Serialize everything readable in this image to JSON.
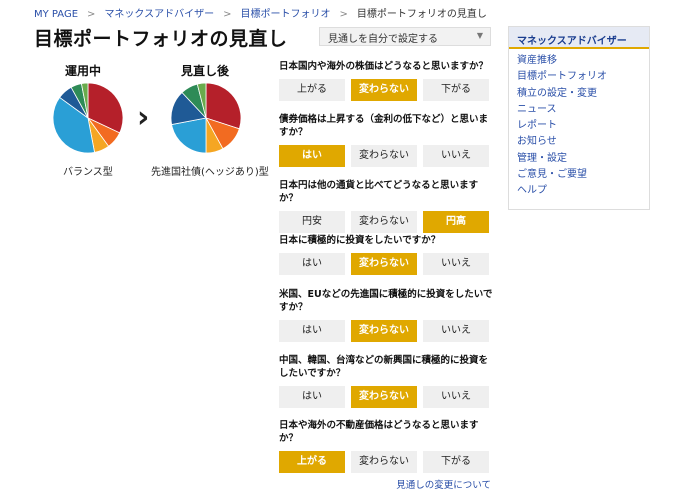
{
  "breadcrumb": [
    "MY PAGE",
    "マネックスアドバイザー",
    "目標ポートフォリオ",
    "目標ポートフォリオの見直し"
  ],
  "page_title": "目標ポートフォリオの見直し",
  "mode_select": {
    "value": "見通しを自分で設定する"
  },
  "current": {
    "label": "運用中",
    "caption": "バランス型"
  },
  "revised": {
    "label": "見直し後",
    "caption": "先進国社債(ヘッジあり)型"
  },
  "pie_colors": [
    "#b5202a",
    "#f26b21",
    "#f5a623",
    "#2a9fd6",
    "#1f5a96",
    "#2e8b57",
    "#6aab4c"
  ],
  "pie_current": [
    0.32,
    0.08,
    0.07,
    0.38,
    0.07,
    0.05,
    0.03
  ],
  "pie_revised": [
    0.3,
    0.12,
    0.08,
    0.22,
    0.16,
    0.08,
    0.04
  ],
  "questions": [
    {
      "text": "日本国内や海外の株価はどうなると思いますか？",
      "options": [
        "上がる",
        "変わらない",
        "下がる"
      ],
      "selected": 1
    },
    {
      "text": "債券価格は上昇する（金利の低下など）と思いますか？",
      "options": [
        "はい",
        "変わらない",
        "いいえ"
      ],
      "selected": 0
    },
    {
      "text": "日本円は他の通貨と比べてどうなると思いますか？",
      "options": [
        "円安",
        "変わらない",
        "円高"
      ],
      "selected": 2
    },
    {
      "text": "日本に積極的に投資をしたいですか？",
      "options": [
        "はい",
        "変わらない",
        "いいえ"
      ],
      "selected": 1
    },
    {
      "text": "米国、EUなどの先進国に積極的に投資をしたいですか？",
      "options": [
        "はい",
        "変わらない",
        "いいえ"
      ],
      "selected": 1
    },
    {
      "text": "中国、韓国、台湾などの新興国に積極的に投資をしたいですか？",
      "options": [
        "はい",
        "変わらない",
        "いいえ"
      ],
      "selected": 1
    },
    {
      "text": "日本や海外の不動産価格はどうなると思いますか？",
      "options": [
        "上がる",
        "変わらない",
        "下がる"
      ],
      "selected": 0
    }
  ],
  "footer_link": "見通しの変更について",
  "sidebar": {
    "title": "マネックスアドバイザー",
    "items": [
      "資産推移",
      "目標ポートフォリオ",
      "積立の設定・変更",
      "ニュース",
      "レポート",
      "お知らせ",
      "管理・設定",
      "ご意見・ご要望",
      "ヘルプ"
    ]
  }
}
